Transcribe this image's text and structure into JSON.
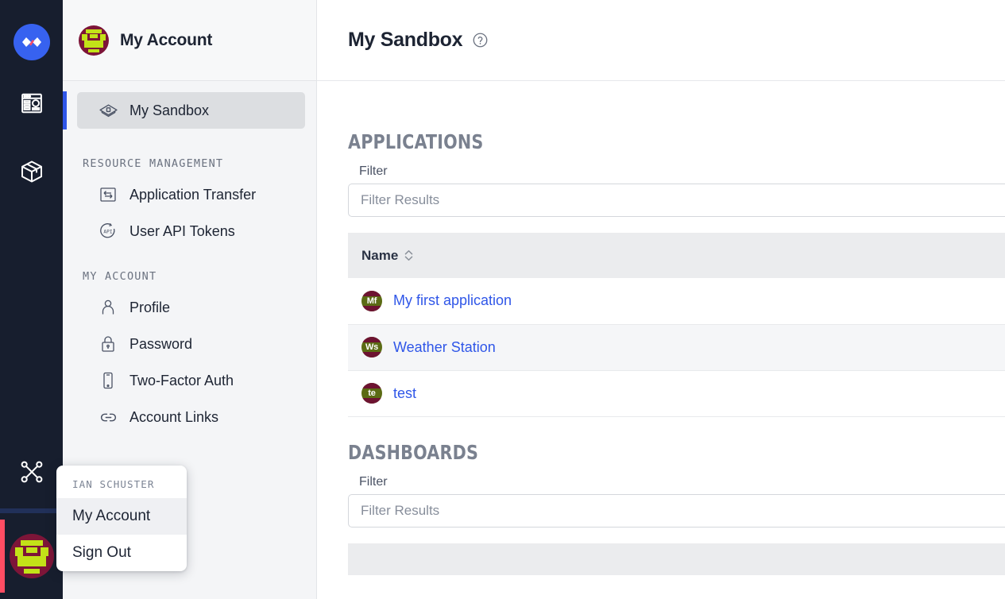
{
  "colors": {
    "rail_bg": "#171e2e",
    "logo_blue": "#3762f0",
    "accent_blue": "#2f56e8",
    "active_red": "#ff4d63",
    "sidebar_bg": "#f4f5f7",
    "link_blue": "#2f56e8",
    "section_gray": "#7a818f",
    "avatar_maroon": "#7d1538",
    "avatar_green": "#c3e218"
  },
  "rail": {
    "logo_name": "platform-logo",
    "items": [
      {
        "name": "dashboard-icon",
        "label": "Dashboards"
      },
      {
        "name": "package-icon",
        "label": "Resources"
      },
      {
        "name": "integrations-icon",
        "label": "Integrations"
      }
    ],
    "user_avatar_label": "User avatar"
  },
  "sidebar": {
    "header": {
      "title": "My Account",
      "avatar_label": "Account avatar"
    },
    "items": [
      {
        "label": "My Sandbox",
        "icon": "sandbox-icon",
        "active": true
      }
    ],
    "sections": [
      {
        "label": "RESOURCE MANAGEMENT",
        "items": [
          {
            "label": "Application Transfer",
            "icon": "transfer-icon"
          },
          {
            "label": "User API Tokens",
            "icon": "api-token-icon"
          }
        ]
      },
      {
        "label": "MY ACCOUNT",
        "items": [
          {
            "label": "Profile",
            "icon": "person-icon"
          },
          {
            "label": "Password",
            "icon": "lock-icon"
          },
          {
            "label": "Two-Factor Auth",
            "icon": "mobile-icon"
          },
          {
            "label": "Account Links",
            "icon": "link-icon"
          }
        ]
      }
    ]
  },
  "popup_menu": {
    "header": "IAN SCHUSTER",
    "items": [
      {
        "label": "My Account",
        "highlighted": true
      },
      {
        "label": "Sign Out",
        "highlighted": false
      }
    ]
  },
  "main": {
    "page_title": "My Sandbox",
    "help_icon": "question-circle-icon",
    "applications": {
      "section_title": "APPLICATIONS",
      "filter_label": "Filter",
      "filter_placeholder": "Filter Results",
      "filter_value": "",
      "column_name": "Name",
      "sort_icon": "sort-updown-icon",
      "rows": [
        {
          "initials": "Mf",
          "name": "My first application"
        },
        {
          "initials": "Ws",
          "name": "Weather Station"
        },
        {
          "initials": "te",
          "name": "test"
        }
      ]
    },
    "dashboards": {
      "section_title": "DASHBOARDS",
      "filter_label": "Filter",
      "filter_placeholder": "Filter Results",
      "filter_value": ""
    }
  }
}
